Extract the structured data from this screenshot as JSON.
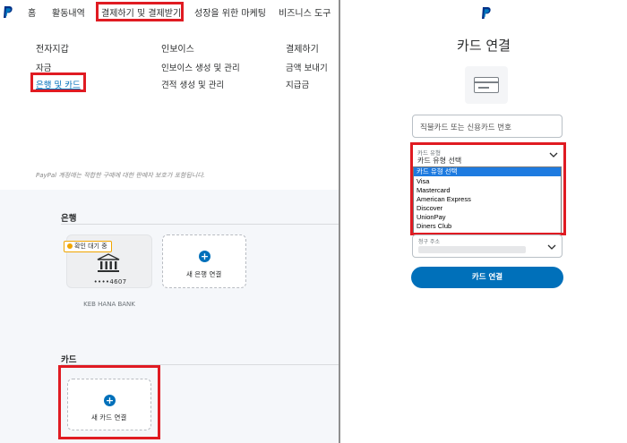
{
  "left": {
    "nav": {
      "home": "홈",
      "activity": "활동내역",
      "pay_get_paid": "결제하기 및 결제받기",
      "marketing": "성장을 위한 마케팅",
      "business_tools": "비즈니스 도구"
    },
    "menu": {
      "col1_heading": "전자지갑",
      "col1_item1": "자금",
      "col1_item2": "은행 및 카드",
      "col2_heading": "인보이스",
      "col2_item1": "인보이스 생성 및 관리",
      "col2_item2": "견적 생성 및 관리",
      "col3_heading": "결제하기",
      "col3_item1": "금액 보내기",
      "col3_item2": "지급금"
    },
    "protection_note": "PayPal 계정에는 적합한 구매에 대한 판매자 보호가 포함됩니다.",
    "banks": {
      "title": "은행",
      "badge": "확인 대기 중",
      "masked_number": "••••4607",
      "bank_name": "KEB HANA BANK",
      "add_bank": "새 은행 연결",
      "plus": "+"
    },
    "cards": {
      "title": "카드",
      "add_card": "새 카드 연결",
      "plus": "+"
    }
  },
  "right": {
    "title": "카드 연결",
    "card_number_placeholder": "직불카드 또는 신용카드 번호",
    "card_type": {
      "label": "카드 유형",
      "value": "카드 유형 선택",
      "options": [
        "카드 유형 선택",
        "Visa",
        "Mastercard",
        "American Express",
        "Discover",
        "UnionPay",
        "Diners Club"
      ]
    },
    "billing_address_label": "청구 주소",
    "submit": "카드 연결"
  },
  "colors": {
    "accent": "#0070ba",
    "highlight": "#e01b22",
    "pending": "#f0a500",
    "selected_option": "#1e7be0"
  },
  "icons": [
    "paypal-logo-icon",
    "bank-icon",
    "plus-icon",
    "credit-card-icon",
    "chevron-down-icon"
  ]
}
